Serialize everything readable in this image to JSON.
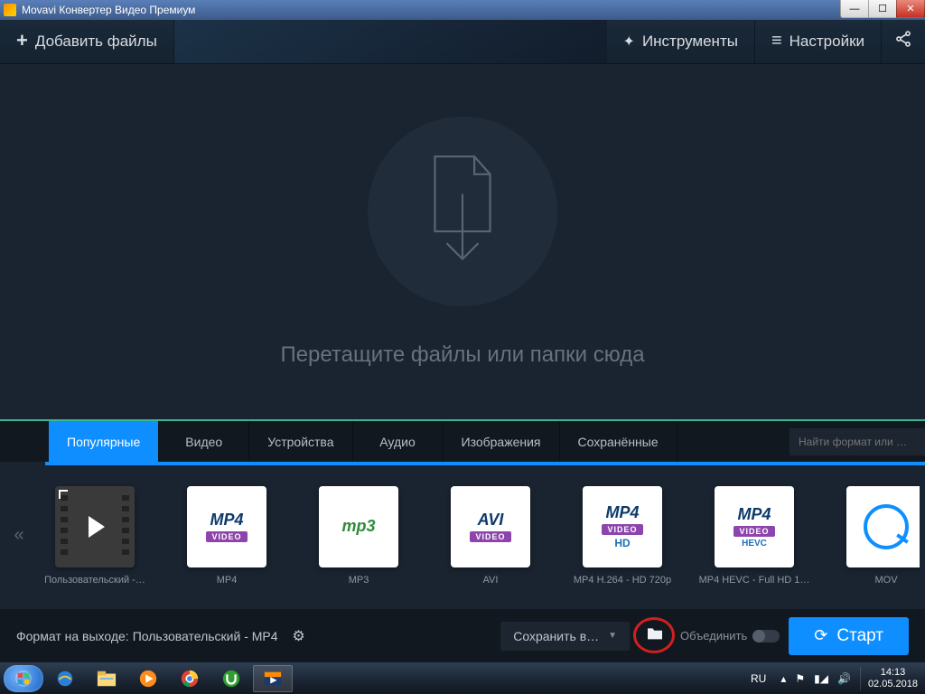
{
  "title_bar": {
    "title": "Movavi Конвертер Видео Премиум"
  },
  "toolbar": {
    "add_files": "Добавить файлы",
    "tools": "Инструменты",
    "settings": "Настройки"
  },
  "drop": {
    "hint": "Перетащите файлы или папки сюда"
  },
  "tabs": {
    "items": [
      "Популярные",
      "Видео",
      "Устройства",
      "Аудио",
      "Изображения",
      "Сохранённые"
    ],
    "search_placeholder": "Найти формат или …"
  },
  "presets": {
    "items": [
      {
        "label": "Пользовательский -…"
      },
      {
        "label": "MP4"
      },
      {
        "label": "MP3"
      },
      {
        "label": "AVI"
      },
      {
        "label": "MP4 H.264 - HD 720p"
      },
      {
        "label": "MP4 HEVC - Full HD 1…"
      },
      {
        "label": "MOV"
      }
    ]
  },
  "bottom": {
    "format_prefix": "Формат на выходе:",
    "format_value": "Пользовательский - MP4",
    "save_to": "Сохранить в…",
    "merge": "Объединить",
    "start": "Старт"
  },
  "taskbar": {
    "lang": "RU",
    "time": "14:13",
    "date": "02.05.2018"
  }
}
